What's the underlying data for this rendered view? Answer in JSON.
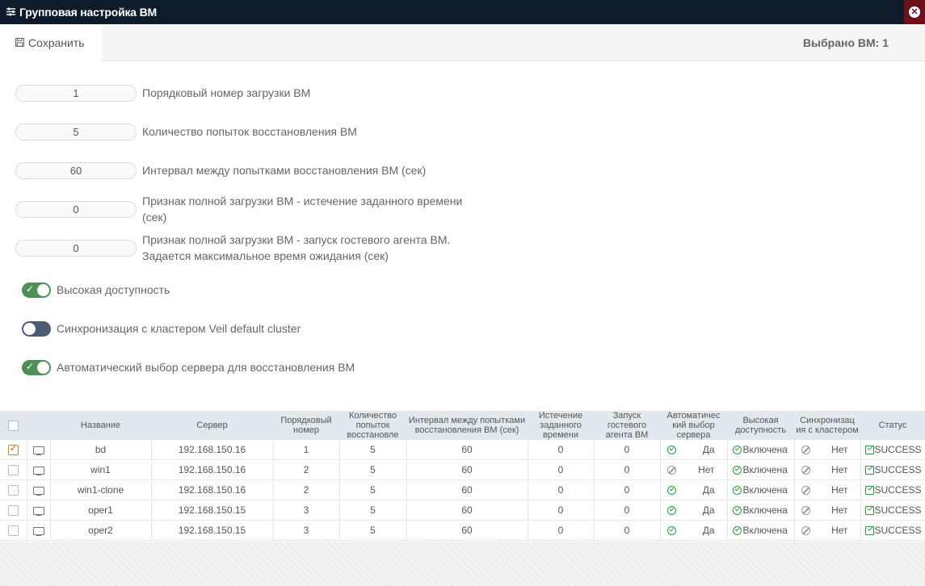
{
  "window": {
    "title": "Групповая настройка ВМ",
    "title_icon": "sliders-icon",
    "close_icon": "close-icon",
    "colors": {
      "titlebar_bg": "#0e1b2b",
      "close_bg": "#6d1018",
      "toggle_on": "#4e8f58",
      "toggle_off": "#4a5b72",
      "ok_green": "#2b9a3a"
    }
  },
  "toolbar": {
    "save_label": "Сохранить",
    "save_icon": "floppy-disk-icon",
    "selected_vm": "Выбрано ВМ: 1"
  },
  "form": {
    "fields": [
      {
        "value": "1",
        "label_line1": "Порядковый номер загрузки ВМ",
        "label_line2": ""
      },
      {
        "value": "5",
        "label_line1": "Количество попыток восстановления ВМ",
        "label_line2": ""
      },
      {
        "value": "60",
        "label_line1": "Интервал между попытками восстановления ВМ (сек)",
        "label_line2": ""
      },
      {
        "value": "0",
        "label_line1": "Признак полной загрузки ВМ - истечение заданного времени",
        "label_line2": "(сек)"
      },
      {
        "value": "0",
        "label_line1": "Признак полной загрузки ВМ - запуск гостевого агента ВМ.",
        "label_line2": "Задается максимальное время ожидания (сек)"
      }
    ],
    "toggles": [
      {
        "label": "Высокая доступность",
        "on": true
      },
      {
        "label": "Синхронизация с кластером Veil default cluster",
        "on": false
      },
      {
        "label": "Автоматический выбор сервера для восстановления ВМ",
        "on": true
      }
    ]
  },
  "table": {
    "headers": {
      "name": "Название",
      "server": "Сервер",
      "order": "Порядковый номер",
      "attempts": "Количество попыток восстановле",
      "interval": "Интервал между попытками восстановления ВМ (сек)",
      "timeout": "Истечение заданного времени",
      "agent": "Запуск гостевого агента ВМ",
      "auto": "Автоматичес кий выбор сервера",
      "ha": "Высокая доступность",
      "sync": "Синхронизац ия с кластером",
      "status": "Статус"
    },
    "rows": [
      {
        "checked": true,
        "name": "bd",
        "server": "192.168.150.16",
        "order": "1",
        "attempts": "5",
        "interval": "60",
        "timeout": "0",
        "agent": "0",
        "auto": "Да",
        "auto_ok": true,
        "ha": "Включена",
        "sync": "Нет",
        "status": "SUCCESS"
      },
      {
        "checked": false,
        "name": "win1",
        "server": "192.168.150.16",
        "order": "2",
        "attempts": "5",
        "interval": "60",
        "timeout": "0",
        "agent": "0",
        "auto": "Нет",
        "auto_ok": false,
        "ha": "Включена",
        "sync": "Нет",
        "status": "SUCCESS"
      },
      {
        "checked": false,
        "name": "win1-clone",
        "server": "192.168.150.16",
        "order": "2",
        "attempts": "5",
        "interval": "60",
        "timeout": "0",
        "agent": "0",
        "auto": "Да",
        "auto_ok": true,
        "ha": "Включена",
        "sync": "Нет",
        "status": "SUCCESS"
      },
      {
        "checked": false,
        "name": "oper1",
        "server": "192.168.150.15",
        "order": "3",
        "attempts": "5",
        "interval": "60",
        "timeout": "0",
        "agent": "0",
        "auto": "Да",
        "auto_ok": true,
        "ha": "Включена",
        "sync": "Нет",
        "status": "SUCCESS"
      },
      {
        "checked": false,
        "name": "oper2",
        "server": "192.168.150.15",
        "order": "3",
        "attempts": "5",
        "interval": "60",
        "timeout": "0",
        "agent": "0",
        "auto": "Да",
        "auto_ok": true,
        "ha": "Включена",
        "sync": "Нет",
        "status": "SUCCESS"
      }
    ]
  }
}
